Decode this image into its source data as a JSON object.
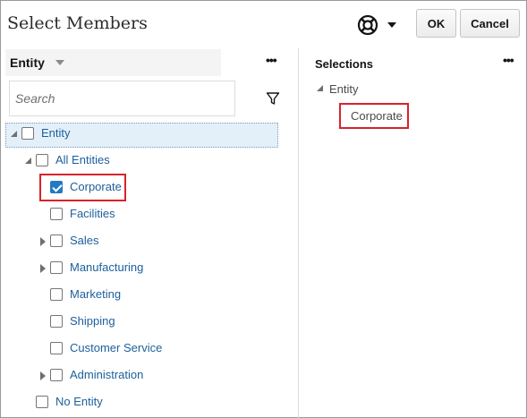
{
  "dialog": {
    "title": "Select Members",
    "ok_label": "OK",
    "cancel_label": "Cancel",
    "help_icon": "lifebuoy-icon"
  },
  "left": {
    "dimension_label": "Entity",
    "more_label": "•••",
    "search_placeholder": "Search",
    "filter_icon": "filter-icon",
    "tree": [
      {
        "label": "Entity",
        "level": 0,
        "expander": "open",
        "checked": false,
        "selected": true
      },
      {
        "label": "All Entities",
        "level": 1,
        "expander": "open",
        "checked": false
      },
      {
        "label": "Corporate",
        "level": 2,
        "expander": "none",
        "checked": true,
        "highlighted": true
      },
      {
        "label": "Facilities",
        "level": 2,
        "expander": "none",
        "checked": false
      },
      {
        "label": "Sales",
        "level": 2,
        "expander": "closed",
        "checked": false
      },
      {
        "label": "Manufacturing",
        "level": 2,
        "expander": "closed",
        "checked": false
      },
      {
        "label": "Marketing",
        "level": 2,
        "expander": "none",
        "checked": false
      },
      {
        "label": "Shipping",
        "level": 2,
        "expander": "none",
        "checked": false
      },
      {
        "label": "Customer Service",
        "level": 2,
        "expander": "none",
        "checked": false
      },
      {
        "label": "Administration",
        "level": 2,
        "expander": "closed",
        "checked": false
      },
      {
        "label": "No Entity",
        "level": 1,
        "expander": "none",
        "checked": false
      }
    ]
  },
  "right": {
    "title": "Selections",
    "more_label": "•••",
    "group_label": "Entity",
    "selected_item": "Corporate"
  },
  "colors": {
    "accent": "#227bc2",
    "link": "#1c5f9c",
    "highlight_border": "#d9222b",
    "selected_row": "#e4f0f9"
  }
}
